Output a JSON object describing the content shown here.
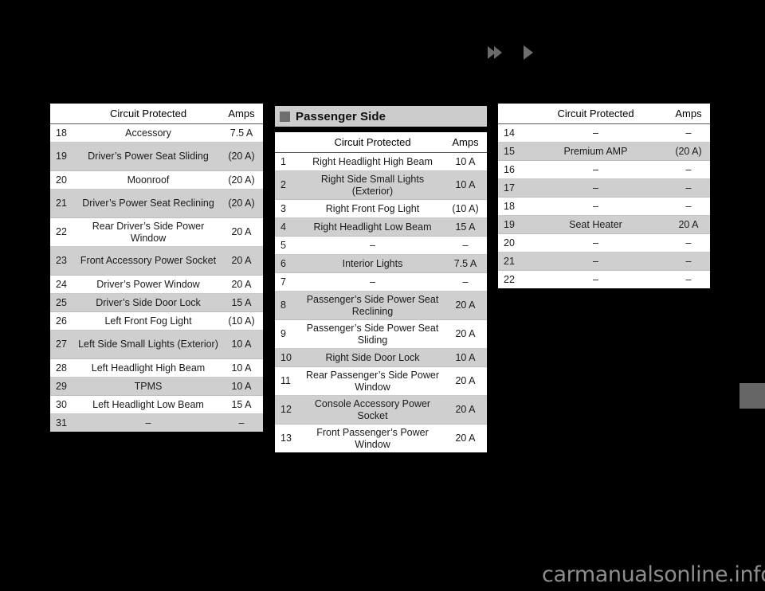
{
  "nav": {
    "arrow_double": "double-right-arrow",
    "arrow_single": "right-arrow"
  },
  "section": {
    "passenger_side_title": "Passenger Side",
    "bullet_icon": "square-bullet-icon"
  },
  "columns": {
    "number": "",
    "circuit": "Circuit Protected",
    "amps": "Amps"
  },
  "table_left": {
    "rows": [
      {
        "num": "18",
        "desc": "Accessory",
        "amps": "7.5 A"
      },
      {
        "num": "19",
        "desc": "Driver’s Power Seat Sliding",
        "amps": "(20 A)"
      },
      {
        "num": "20",
        "desc": "Moonroof",
        "amps": "(20 A)"
      },
      {
        "num": "21",
        "desc": "Driver’s Power Seat Reclining",
        "amps": "(20 A)"
      },
      {
        "num": "22",
        "desc": "Rear Driver’s Side Power Window",
        "amps": "20 A"
      },
      {
        "num": "23",
        "desc": "Front Accessory Power Socket",
        "amps": "20 A"
      },
      {
        "num": "24",
        "desc": "Driver’s Power Window",
        "amps": "20 A"
      },
      {
        "num": "25",
        "desc": "Driver’s Side Door Lock",
        "amps": "15 A"
      },
      {
        "num": "26",
        "desc": "Left Front Fog Light",
        "amps": "(10 A)"
      },
      {
        "num": "27",
        "desc": "Left Side Small Lights (Exterior)",
        "amps": "10 A"
      },
      {
        "num": "28",
        "desc": "Left Headlight High Beam",
        "amps": "10 A"
      },
      {
        "num": "29",
        "desc": "TPMS",
        "amps": "10 A"
      },
      {
        "num": "30",
        "desc": "Left Headlight Low Beam",
        "amps": "15 A"
      },
      {
        "num": "31",
        "desc": "–",
        "amps": "–"
      }
    ]
  },
  "table_mid": {
    "rows": [
      {
        "num": "1",
        "desc": "Right Headlight High Beam",
        "amps": "10 A"
      },
      {
        "num": "2",
        "desc": "Right Side Small Lights (Exterior)",
        "amps": "10 A"
      },
      {
        "num": "3",
        "desc": "Right Front Fog Light",
        "amps": "(10 A)"
      },
      {
        "num": "4",
        "desc": "Right Headlight Low Beam",
        "amps": "15 A"
      },
      {
        "num": "5",
        "desc": "–",
        "amps": "–"
      },
      {
        "num": "6",
        "desc": "Interior Lights",
        "amps": "7.5 A"
      },
      {
        "num": "7",
        "desc": "–",
        "amps": "–"
      },
      {
        "num": "8",
        "desc": "Passenger’s Side Power Seat Reclining",
        "amps": "20 A"
      },
      {
        "num": "9",
        "desc": "Passenger’s Side Power Seat Sliding",
        "amps": "20 A"
      },
      {
        "num": "10",
        "desc": "Right Side Door Lock",
        "amps": "10 A"
      },
      {
        "num": "11",
        "desc": "Rear Passenger’s Side Power Window",
        "amps": "20 A"
      },
      {
        "num": "12",
        "desc": "Console Accessory Power Socket",
        "amps": "20 A"
      },
      {
        "num": "13",
        "desc": "Front Passenger’s Power Window",
        "amps": "20 A"
      }
    ]
  },
  "table_right": {
    "rows": [
      {
        "num": "14",
        "desc": "–",
        "amps": "–"
      },
      {
        "num": "15",
        "desc": "Premium AMP",
        "amps": "(20 A)"
      },
      {
        "num": "16",
        "desc": "–",
        "amps": "–"
      },
      {
        "num": "17",
        "desc": "–",
        "amps": "–"
      },
      {
        "num": "18",
        "desc": "–",
        "amps": "–"
      },
      {
        "num": "19",
        "desc": "Seat Heater",
        "amps": "20 A"
      },
      {
        "num": "20",
        "desc": "–",
        "amps": "–"
      },
      {
        "num": "21",
        "desc": "–",
        "amps": "–"
      },
      {
        "num": "22",
        "desc": "–",
        "amps": "–"
      }
    ]
  },
  "watermark": {
    "text": "carmanualsonline.info"
  },
  "colors": {
    "page_background": "#000000",
    "table_background": "#ffffff",
    "row_alt": "#cfcfcf",
    "section_header": "#cccccc",
    "accent_gray": "#6e6e6e",
    "watermark": "#8d8d8d"
  }
}
